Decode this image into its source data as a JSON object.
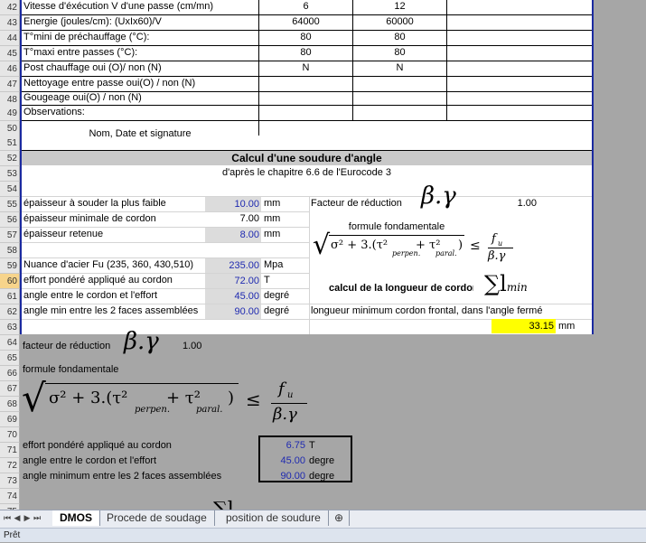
{
  "rows": {
    "numbers": [
      "42",
      "43",
      "44",
      "45",
      "46",
      "47",
      "48",
      "49",
      "50",
      "51",
      "52",
      "53",
      "54",
      "55",
      "56",
      "57",
      "58",
      "59",
      "60",
      "61",
      "62",
      "63",
      "64",
      "65",
      "66",
      "67",
      "68",
      "69",
      "70",
      "71",
      "72",
      "73",
      "74",
      "75"
    ],
    "selected_row": "60",
    "r42": {
      "label": "Vitesse d'éxécution V d'une passe (cm/mn)",
      "v1": "6",
      "v2": "12"
    },
    "r43": {
      "label": "Energie (joules/cm): (UxIx60)/V",
      "v1": "64000",
      "v2": "60000"
    },
    "r44": {
      "label": "T°mini de préchauffage (°C):",
      "v1": "80",
      "v2": "80"
    },
    "r45": {
      "label": "T°maxi entre passes (°C):",
      "v1": "80",
      "v2": "80"
    },
    "r46": {
      "label": "Post chauffage oui (O)/ non (N)",
      "v1": "N",
      "v2": "N"
    },
    "r47": {
      "label": "Nettoyage entre passe oui(O) / non (N)"
    },
    "r48": {
      "label": "Gougeage oui(O) / non (N)"
    },
    "r49": {
      "label": "Observations:"
    },
    "r50": {
      "label": "Nom, Date et signature"
    },
    "r52": {
      "title": "Calcul d'une soudure d'angle"
    },
    "r53": {
      "subtitle": "d'après le chapitre 6.6 de l'Eurocode 3"
    },
    "r55": {
      "label": "épaisseur à souder la plus faible",
      "value": "10.00",
      "unit": "mm",
      "right_label": "Facteur de réduction",
      "right_value": "1.00"
    },
    "r56": {
      "label": "épaisseur minimale de cordon",
      "value": "7.00",
      "unit": "mm",
      "right_label": "formule fondamentale"
    },
    "r57": {
      "label": "épaisseur retenue",
      "value": "8.00",
      "unit": "mm"
    },
    "r59": {
      "label": "Nuance d'acier Fu (235, 360, 430,510)",
      "value": "235.00",
      "unit": "Mpa"
    },
    "r60": {
      "label": "effort pondéré appliqué au cordon",
      "value": "72.00",
      "unit": "T"
    },
    "r61": {
      "label": "angle entre le cordon et l'effort",
      "value": "45.00",
      "unit": "degré",
      "right_label": "calcul de la longueur de cordon"
    },
    "r62": {
      "label": "angle min entre les 2 faces assemblées",
      "value": "90.00",
      "unit": "degré",
      "right_label": "longueur minimum cordon frontal, dans l'angle fermé"
    },
    "r63": {
      "value": "33.15",
      "unit": "mm"
    },
    "r64": {
      "label": "facteur de réduction",
      "value": "1.00"
    },
    "r66": {
      "label": "formule fondamentale"
    },
    "r71": {
      "label": "effort pondéré appliqué au cordon",
      "value": "6.75",
      "unit": "T"
    },
    "r72": {
      "label": "angle entre le cordon et l'effort",
      "value": "45.00",
      "unit": "degre"
    },
    "r73": {
      "label": "angle minimum entre les 2 faces assemblées",
      "value": "90.00",
      "unit": "degre"
    }
  },
  "formulas": {
    "beta_gamma": "β.γ",
    "sum_l": "∑l",
    "sum_l_sub": "min",
    "f_num": "f",
    "f_num_sub": "u",
    "f_den": "β.γ",
    "leq": "≤",
    "sqrt": "√",
    "core": "σ² + 3.(τ²",
    "perpen": "perpen.",
    "plus_tau": " + τ²",
    "paral": "paral.",
    "close": ")"
  },
  "tabs": [
    "DMOS",
    "Procede de soudage",
    "position de soudure"
  ],
  "active_tab": "DMOS",
  "status": "Prêt",
  "colors": {
    "accent_border": "#1b2aa0",
    "value_text": "#1f2ab0",
    "result_fill": "#ffff00"
  }
}
